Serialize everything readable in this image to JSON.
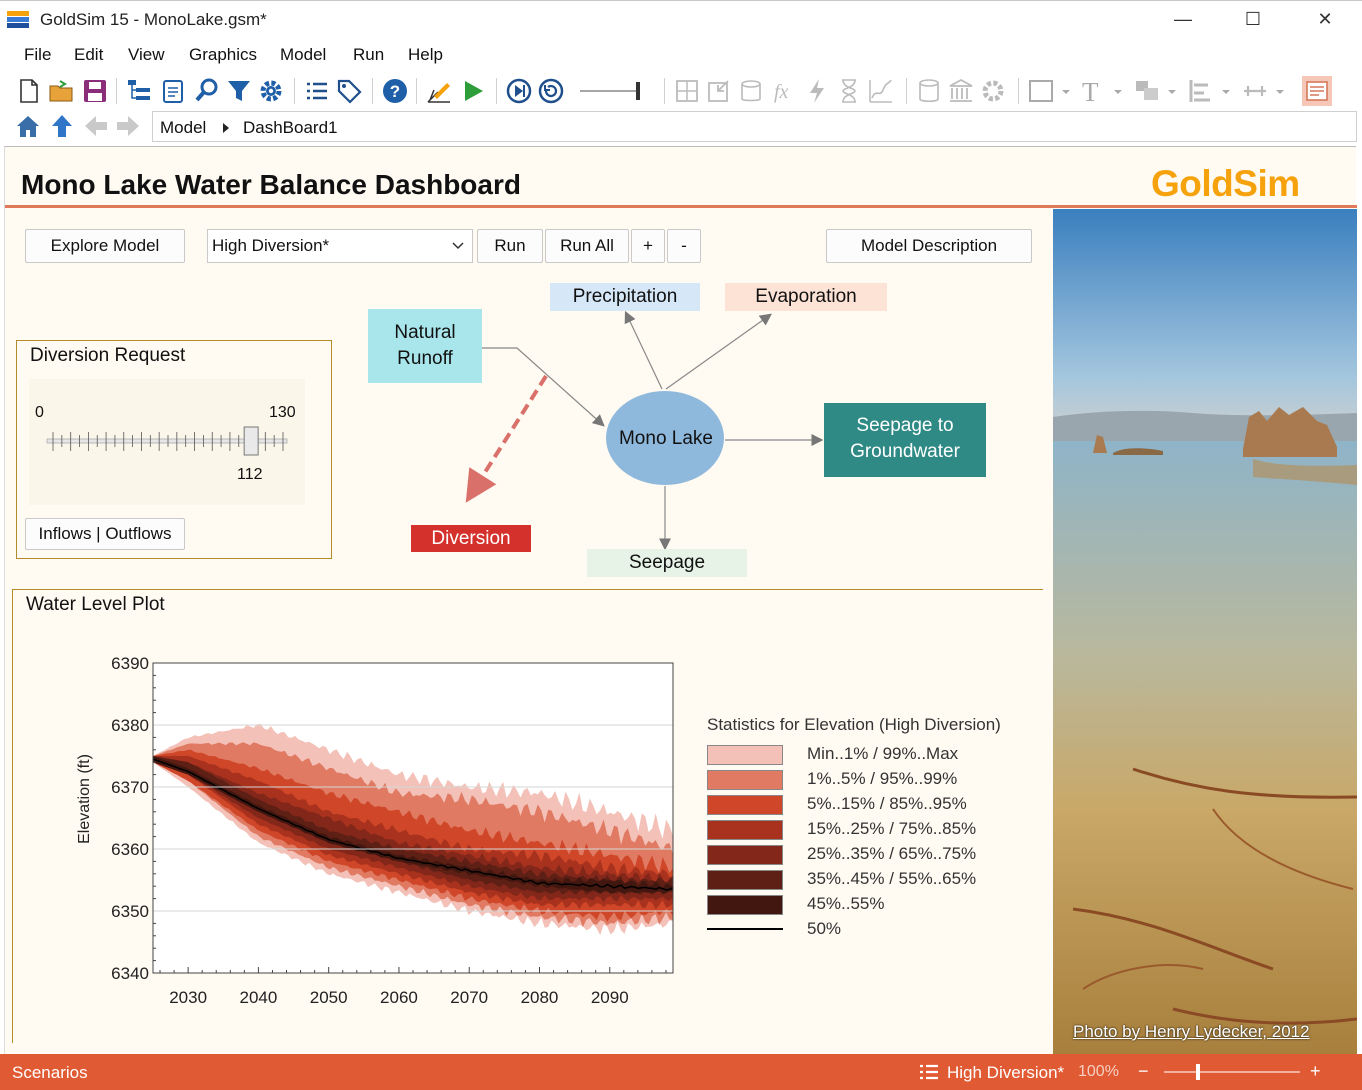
{
  "window": {
    "title": "GoldSim 15  - MonoLake.gsm*",
    "minimize_glyph": "—",
    "maximize_glyph": "☐",
    "close_glyph": "✕"
  },
  "menu": [
    "File",
    "Edit",
    "View",
    "Graphics",
    "Model",
    "Run",
    "Help"
  ],
  "toolbar_icons": [
    "new-file-icon",
    "open-folder-icon",
    "save-icon",
    "browser-icon",
    "notes-icon",
    "find-icon",
    "filter-icon",
    "settings-icon",
    "list-icon",
    "tag-icon",
    "help-icon",
    "edit-mode-icon",
    "run-icon",
    "step-icon",
    "reset-icon"
  ],
  "breadcrumb": [
    "Model",
    "DashBoard1"
  ],
  "dashboard": {
    "title": "Mono Lake Water Balance Dashboard",
    "logo": "GoldSim",
    "photo_credit": "Photo by Henry Lydecker, 2012"
  },
  "controls": {
    "explore_model": "Explore Model",
    "scenario_select": "High Diversion*",
    "run": "Run",
    "run_all": "Run All",
    "plus": "+",
    "minus": "-",
    "model_description": "Model Description"
  },
  "diversion_request": {
    "title": "Diversion Request",
    "min": "0",
    "max": "130",
    "value": "112",
    "value_num": 112,
    "range": [
      0,
      130
    ],
    "toggle_button": "Inflows | Outflows"
  },
  "diagram": {
    "natural_runoff": "Natural\nRunoff",
    "precipitation": "Precipitation",
    "evaporation": "Evaporation",
    "mono_lake": "Mono Lake",
    "seepage_gw": "Seepage to\nGroundwater",
    "diversion": "Diversion",
    "seepage": "Seepage",
    "colors": {
      "runoff": "#a8e6ec",
      "precip": "#d6e8f8",
      "evap": "#fde3d6",
      "lake": "#8fb9dc",
      "gw": "#2f8a85",
      "diversion": "#d4312c",
      "seepage": "#e6f3e6"
    }
  },
  "plot": {
    "title": "Water Level Plot"
  },
  "chart_data": {
    "type": "area",
    "ylabel": "Elevation (ft)",
    "xlabel": "",
    "ylim": [
      6340,
      6390
    ],
    "xlim": [
      2025,
      2099
    ],
    "yticks": [
      "6390",
      "6380",
      "6370",
      "6360",
      "6350",
      "6340"
    ],
    "xticks": [
      "2030",
      "2040",
      "2050",
      "2060",
      "2070",
      "2080",
      "2090"
    ],
    "x": [
      2025,
      2030,
      2040,
      2050,
      2060,
      2070,
      2080,
      2090,
      2099
    ],
    "legend_title": "Statistics for Elevation (High Diversion)",
    "series": [
      {
        "name": "Min..1% / 99%..Max",
        "color": "#f3c1b8",
        "upper": [
          6375,
          6378,
          6380,
          6376,
          6372,
          6370,
          6369,
          6366,
          6363
        ],
        "lower": [
          6374,
          6370,
          6361,
          6356,
          6353,
          6350,
          6348,
          6347,
          6348
        ]
      },
      {
        "name": "1%..5% / 95%..99%",
        "color": "#e07a63",
        "upper": [
          6375,
          6377,
          6377,
          6373,
          6369,
          6368,
          6366,
          6363,
          6360
        ],
        "lower": [
          6374,
          6371,
          6362,
          6357,
          6354,
          6351,
          6349,
          6348,
          6349
        ]
      },
      {
        "name": "5%..15% / 85%..95%",
        "color": "#cf4628",
        "upper": [
          6375,
          6376,
          6373,
          6369,
          6366,
          6363,
          6361,
          6359,
          6357
        ],
        "lower": [
          6374,
          6371,
          6363,
          6358,
          6355,
          6352,
          6350,
          6349,
          6350
        ]
      },
      {
        "name": "15%..25% / 75%..85%",
        "color": "#a8321d",
        "upper": [
          6375,
          6375,
          6371,
          6366,
          6363,
          6360,
          6359,
          6357,
          6356
        ],
        "lower": [
          6374,
          6372,
          6364,
          6359,
          6356,
          6353,
          6351,
          6351,
          6351
        ]
      },
      {
        "name": "25%..35% / 65%..75%",
        "color": "#82271a",
        "upper": [
          6375,
          6374,
          6369,
          6365,
          6361,
          6359,
          6357,
          6356,
          6355
        ],
        "lower": [
          6374,
          6372,
          6365,
          6360,
          6357,
          6354,
          6352,
          6352,
          6352
        ]
      },
      {
        "name": "35%..45% / 55%..65%",
        "color": "#5e1f15",
        "upper": [
          6375,
          6374,
          6368,
          6363,
          6360,
          6358,
          6356,
          6355,
          6355
        ],
        "lower": [
          6374,
          6372,
          6366,
          6361,
          6358,
          6355,
          6353,
          6353,
          6353
        ]
      },
      {
        "name": "45%..55%",
        "color": "#421710",
        "upper": [
          6375,
          6373,
          6367,
          6362,
          6359,
          6357,
          6355,
          6355,
          6354
        ],
        "lower": [
          6374,
          6372,
          6366,
          6361,
          6358,
          6356,
          6354,
          6353,
          6353
        ]
      }
    ],
    "median": {
      "name": "50%",
      "color": "#000000",
      "values": [
        6374.5,
        6372.5,
        6366.5,
        6361.5,
        6358.5,
        6356.5,
        6354.5,
        6354,
        6353.5
      ]
    }
  },
  "statusbar": {
    "left": "Scenarios",
    "scenario": "High Diversion*",
    "zoom": "100%",
    "zoom_minus": "−",
    "zoom_plus": "+"
  }
}
